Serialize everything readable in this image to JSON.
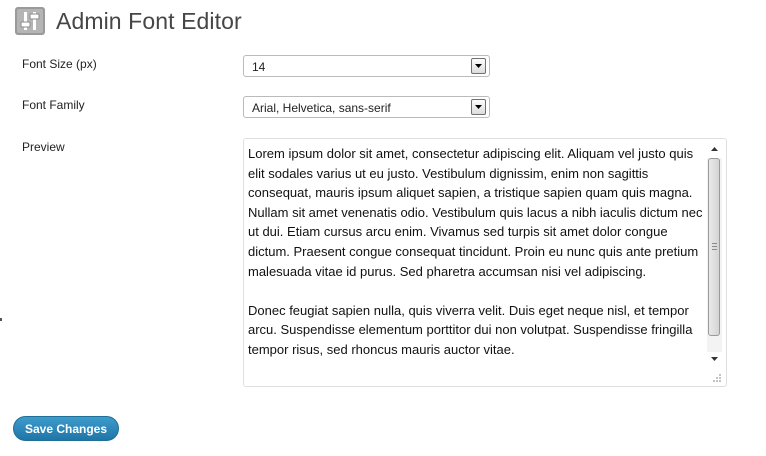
{
  "header": {
    "title": "Admin Font Editor",
    "icon": "settings-sliders-icon"
  },
  "form": {
    "font_size": {
      "label": "Font Size (px)",
      "selected": "14"
    },
    "font_family": {
      "label": "Font Family",
      "selected": "Arial, Helvetica, sans-serif"
    },
    "preview": {
      "label": "Preview",
      "text": "Lorem ipsum dolor sit amet, consectetur adipiscing elit. Aliquam vel justo quis elit sodales varius ut eu justo. Vestibulum dignissim, enim non sagittis consequat, mauris ipsum aliquet sapien, a tristique sapien quam quis magna. Nullam sit amet venenatis odio. Vestibulum quis lacus a nibh iaculis dictum nec ut dui. Etiam cursus arcu enim. Vivamus sed turpis sit amet dolor congue dictum. Praesent congue consequat tincidunt. Proin eu nunc quis ante pretium malesuada vitae id purus. Sed pharetra accumsan nisi vel adipiscing.\n\nDonec feugiat sapien nulla, quis viverra velit. Duis eget neque nisl, et tempor arcu. Suspendisse elementum porttitor dui non volutpat. Suspendisse fringilla tempor risus, sed rhoncus mauris auctor vitae."
    }
  },
  "actions": {
    "save_label": "Save Changes"
  },
  "colors": {
    "save_button": "#2a84b8",
    "title_text": "#464646"
  }
}
